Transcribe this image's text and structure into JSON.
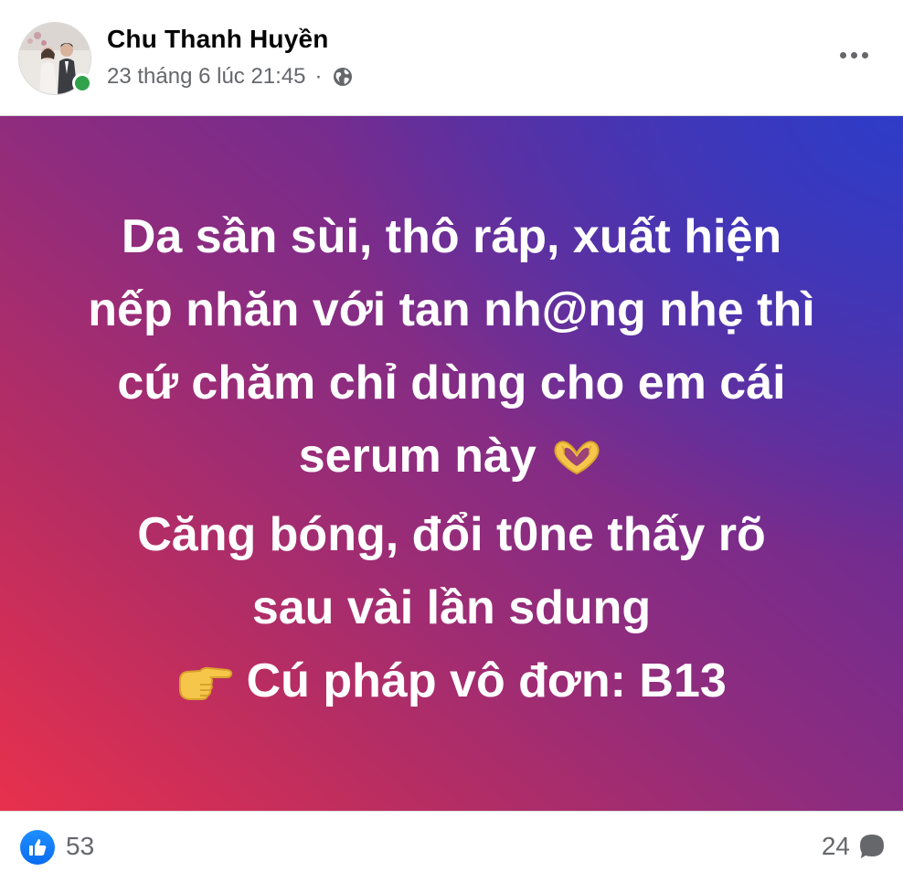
{
  "post": {
    "author": "Chu Thanh Huyền",
    "timestamp": "23 tháng 6 lúc 21:45",
    "separator": "·",
    "privacy_icon": "globe-icon",
    "more_icon": "more-horizontal-icon",
    "avatar_icon": "profile-photo"
  },
  "status": {
    "background_colors": [
      "#e8304d",
      "#8c2c80",
      "#3a3cc8"
    ],
    "lines": [
      "Da sần sùi, thô ráp, xuất hiện",
      "nếp nhăn với tan nh@ng nhẹ thì",
      "cứ chăm chỉ dùng cho em cái",
      "serum này",
      "Căng bóng, đổi t0ne thấy rõ",
      "sau vài lần sdung",
      "Cú pháp vô đơn: B13"
    ],
    "line4_emoji": "heart-hands-icon",
    "line7_emoji": "pointing-right-icon"
  },
  "footer": {
    "like_count": "53",
    "comment_count": "24",
    "like_icon": "thumbs-up-icon",
    "comment_icon": "comment-bubble-icon",
    "accent_color": "#0a6cf0"
  }
}
